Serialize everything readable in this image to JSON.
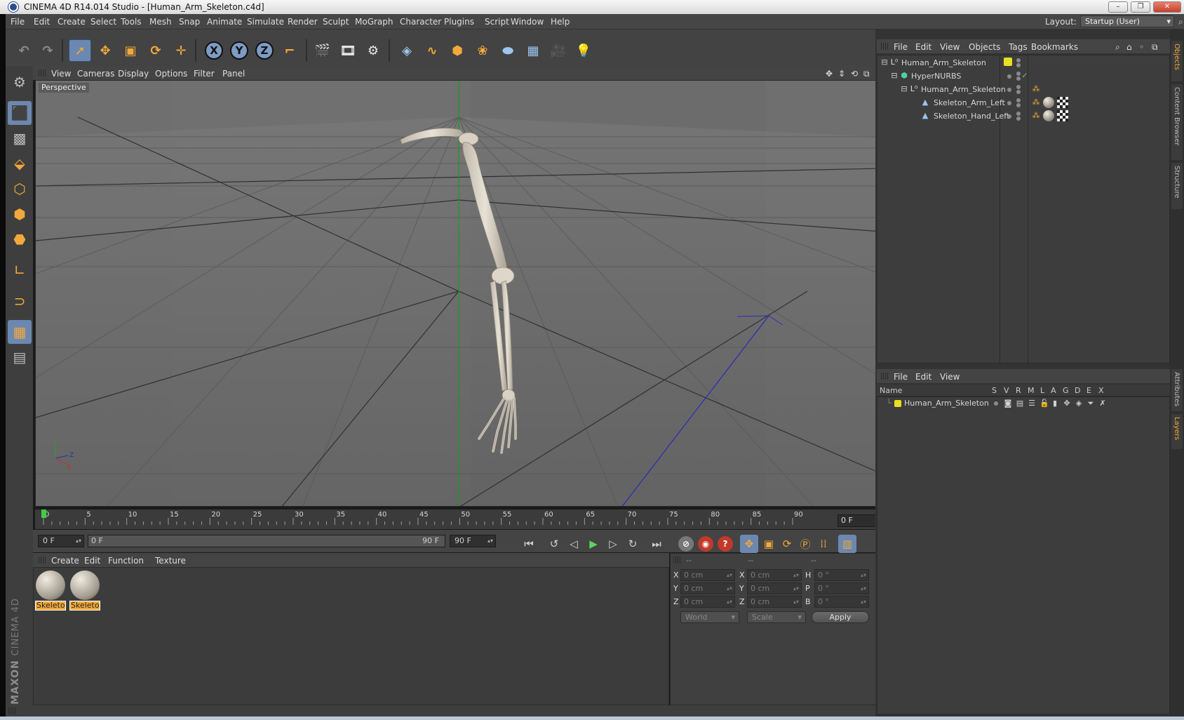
{
  "window": {
    "title": "CINEMA 4D R14.014 Studio - [Human_Arm_Skeleton.c4d]",
    "buttons": [
      "–",
      "❐",
      "✕"
    ]
  },
  "menubar": {
    "items": [
      "File",
      "Edit",
      "Create",
      "Select",
      "Tools",
      "Mesh",
      "Snap",
      "Animate",
      "Simulate",
      "Render",
      "Sculpt",
      "MoGraph",
      "Character",
      "Plugins",
      "Script",
      "Window",
      "Help"
    ],
    "layout_label": "Layout:",
    "layout_value": "Startup (User)"
  },
  "toolbar": {
    "axes": [
      "X",
      "Y",
      "Z"
    ]
  },
  "viewport": {
    "menu": [
      "View",
      "Cameras",
      "Display",
      "Options",
      "Filter",
      "Panel"
    ],
    "camera_label": "Perspective",
    "axis_labels": [
      "Y",
      "Z",
      "X"
    ]
  },
  "timeline": {
    "ticks": [
      "0",
      "5",
      "10",
      "15",
      "20",
      "25",
      "30",
      "35",
      "40",
      "45",
      "50",
      "55",
      "60",
      "65",
      "70",
      "75",
      "80",
      "85",
      "90"
    ],
    "current_frame": "0 F"
  },
  "transport": {
    "start_field": "0 F",
    "range_start": "0 F",
    "range_end": "90 F",
    "end_field": "90 F"
  },
  "material_manager": {
    "menu": [
      "Create",
      "Edit",
      "Function",
      "Texture"
    ],
    "materials": [
      {
        "label": "Skeleton"
      },
      {
        "label": "Skeleton"
      }
    ]
  },
  "coordinates": {
    "headers": [
      "--",
      "--",
      "--"
    ],
    "rows": [
      {
        "pos_label": "X",
        "pos": "0 cm",
        "size_label": "X",
        "size": "0 cm",
        "rot_label": "H",
        "rot": "0 °"
      },
      {
        "pos_label": "Y",
        "pos": "0 cm",
        "size_label": "Y",
        "size": "0 cm",
        "rot_label": "P",
        "rot": "0 °"
      },
      {
        "pos_label": "Z",
        "pos": "0 cm",
        "size_label": "Z",
        "size": "0 cm",
        "rot_label": "B",
        "rot": "0 °"
      }
    ],
    "space_dropdown": "World",
    "mode_dropdown": "Scale",
    "apply_label": "Apply"
  },
  "object_manager": {
    "menu": [
      "File",
      "Edit",
      "View",
      "Objects",
      "Tags",
      "Bookmarks"
    ],
    "objects": [
      {
        "name": "Human_Arm_Skeleton",
        "icon": "null-icon"
      },
      {
        "name": "HyperNURBS",
        "icon": "hypernurbs-icon"
      },
      {
        "name": "Human_Arm_Skeleton",
        "icon": "null-icon"
      },
      {
        "name": "Skeleton_Arm_Left",
        "icon": "polygon-icon"
      },
      {
        "name": "Skeleton_Hand_Left",
        "icon": "polygon-icon"
      }
    ],
    "layer_color": "#e8e020"
  },
  "layer_manager": {
    "menu": [
      "File",
      "Edit",
      "View"
    ],
    "columns": [
      "Name",
      "S",
      "V",
      "R",
      "M",
      "L",
      "A",
      "G",
      "D",
      "E",
      "X"
    ],
    "layers": [
      {
        "name": "Human_Arm_Skeleton",
        "color": "#e8e020"
      }
    ]
  },
  "side_tabs": {
    "top": [
      "Objects",
      "Content Browser",
      "Structure"
    ],
    "bottom": [
      "Attributes",
      "Layers"
    ]
  },
  "branding": {
    "logo": "MAXON",
    "product": "CINEMA 4D"
  },
  "colors": {
    "accent": "#f2a93b",
    "selected": "#6c88b0"
  }
}
